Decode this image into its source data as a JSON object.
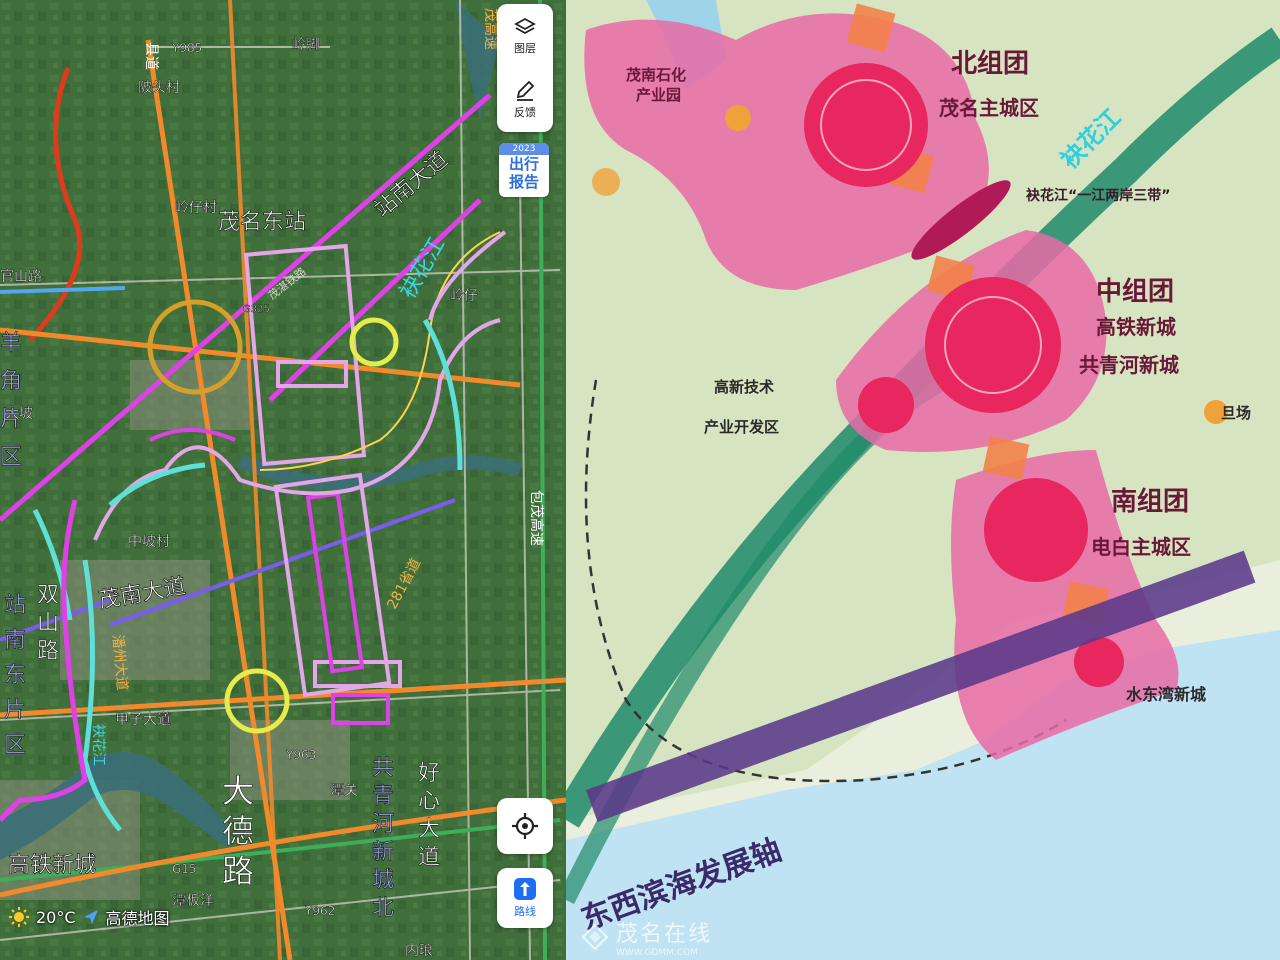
{
  "satellite_map": {
    "road_labels": {
      "county_road": "县道",
      "y985": "Y985",
      "linjiao": "岭脚",
      "maomao_expressway_top": "茂高速",
      "lingtou_village": "陂头村",
      "lingzai_village": "岭仔村",
      "yuanjie": "官山路",
      "lingzai": "岭仔",
      "dapo": "大坡",
      "zhongpo_village": "中坡村",
      "jiazi_avenue": "甲子大道",
      "y963": "Y963",
      "tanguan": "潭关",
      "g15": "G15",
      "tanbanyang": "潭板洋",
      "y962": "Y962",
      "neilang": "内琅",
      "baomao_expressway": "包茂高速",
      "provincial_281": "281省道",
      "panzhou_avenue": "潘州大道",
      "g325": "G325",
      "maozhan_rail": "茂湛铁路"
    },
    "annotations": {
      "maoming_east_station": "茂名东站",
      "zhannan_avenue": "站南大道",
      "xiaohua_river": "袂花江",
      "maonan_avenue": "茂南大道",
      "shuangshan_road": "双山路",
      "xiaohua_river_small": "袂花江",
      "high_speed_rail_city": "高铁新城",
      "dade_road": "大德路",
      "gongqinghe_north": "共青河新城北",
      "haoxin_avenue": "好心大道",
      "yangjiao_district": "羊角片区",
      "zhannan_east_district": "站南东片区"
    },
    "controls": {
      "layer_label": "图层",
      "feedback_label": "反馈",
      "report_year": "2023",
      "report_title_1": "出行",
      "report_title_2": "报告",
      "route_label": "路线"
    },
    "bottom_bar": {
      "temperature": "20°C",
      "brand": "高德地图"
    }
  },
  "plan_map": {
    "north_group": "北组团",
    "maoming_main_city": "茂名主城区",
    "xiaohua_label": "袂花江",
    "maonan_petrochem": "茂南石化产业园",
    "river_banks": "袂花江“一江两岸三带”",
    "middle_group": "中组团",
    "hsr_new_city": "高铁新城",
    "gongqinghe_new_city": "共青河新城",
    "gaoxin_zone": "高新技术产业开发区",
    "danshan": "旦场",
    "south_group": "南组团",
    "dianbai_main_city": "电白主城区",
    "shuidonggang": "水东湾新城",
    "coastal_axis": "东西滨海发展轴"
  },
  "watermark": {
    "text": "茂名在线",
    "url": "WWW.GDMM.COM"
  },
  "colors": {
    "satellite_green": "#3e6b3a",
    "orange_road": "#f28a2b",
    "magenta_line": "#e040e8",
    "plan_pink": "#e86aa6",
    "plan_core": "#e8275e",
    "sea_blue": "#bfe3f2",
    "axis_purple": "#5b3a8a",
    "river_green": "#1f8a6a"
  }
}
